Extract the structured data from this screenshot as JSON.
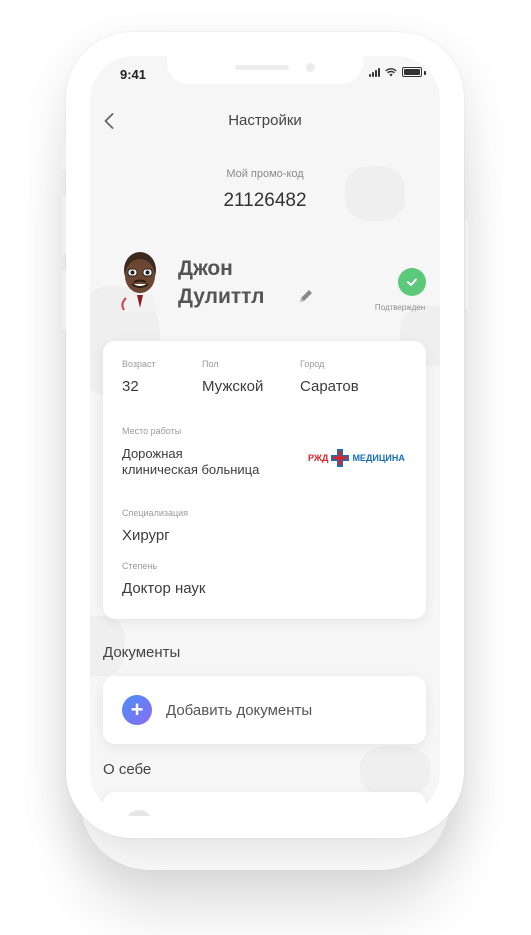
{
  "status_bar": {
    "time": "9:41"
  },
  "header": {
    "title": "Настройки"
  },
  "promo": {
    "label": "Мой промо-код",
    "code": "21126482"
  },
  "profile": {
    "first_name": "Джон",
    "last_name": "Дулиттл",
    "verified_label": "Подтвержден",
    "verified_color": "#5cc97a"
  },
  "info": {
    "age_label": "Возраст",
    "age_value": "32",
    "gender_label": "Пол",
    "gender_value": "Мужской",
    "city_label": "Город",
    "city_value": "Саратов",
    "work_label": "Место работы",
    "work_value_line1": "Дорожная",
    "work_value_line2": "клиническая больница",
    "work_logo_left": "РЖД",
    "work_logo_right": "МЕДИЦИНА",
    "specialization_label": "Специализация",
    "specialization_value": "Хирург",
    "degree_label": "Степень",
    "degree_value": "Доктор наук"
  },
  "documents": {
    "section_title": "Документы",
    "add_label": "Добавить документы",
    "accent_from": "#4a8df6",
    "accent_to": "#8b6cf0"
  },
  "about": {
    "section_title": "О себе"
  },
  "icons": [
    "back-icon",
    "edit-icon",
    "verified-check-icon",
    "add-icon",
    "signal-icon",
    "wifi-icon",
    "battery-icon"
  ]
}
